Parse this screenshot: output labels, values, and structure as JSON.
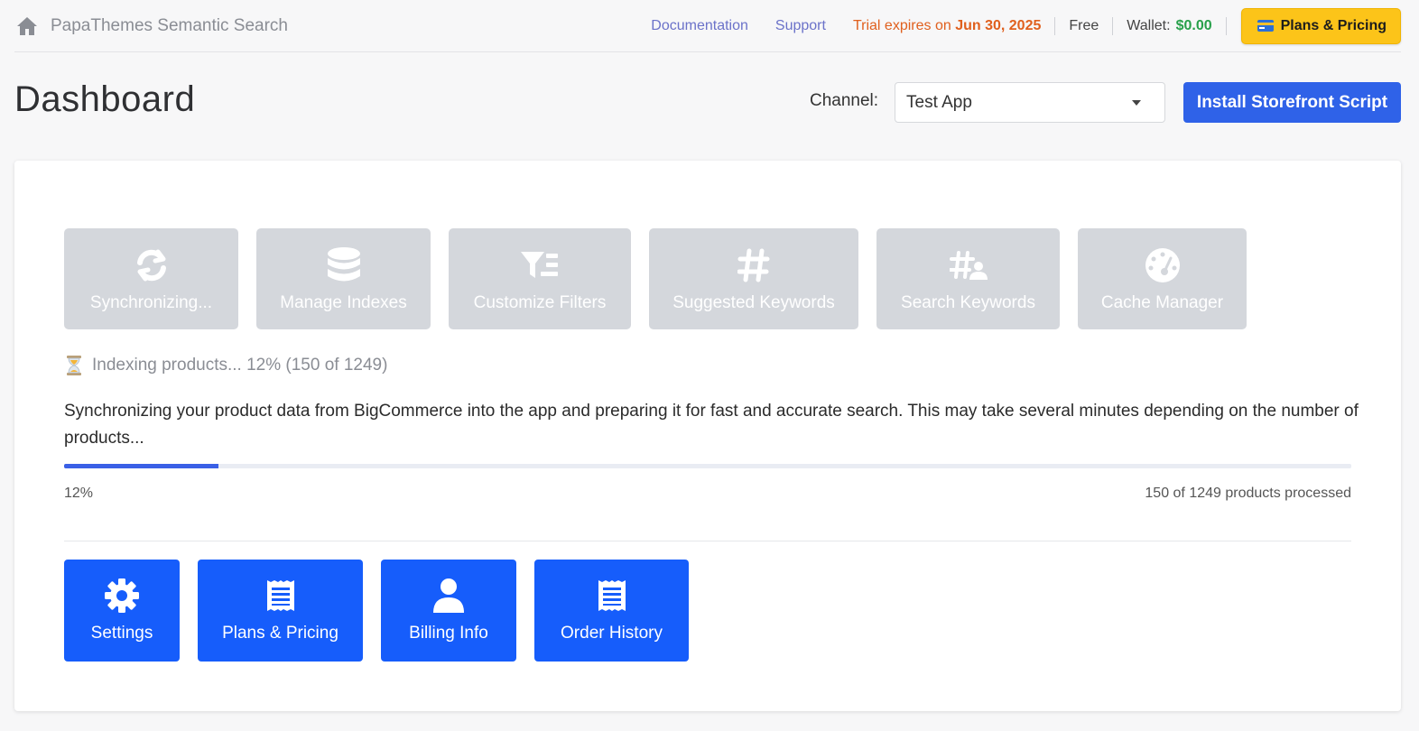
{
  "header": {
    "app_title": "PapaThemes Semantic Search",
    "documentation": "Documentation",
    "support": "Support",
    "trial_prefix": "Trial expires on",
    "trial_date": "Jun 30, 2025",
    "plan": "Free",
    "wallet_label": "Wallet:",
    "wallet_value": "$0.00",
    "plans_button": "Plans & Pricing"
  },
  "page": {
    "title": "Dashboard",
    "channel_label": "Channel:",
    "channel_value": "Test App",
    "install_button": "Install Storefront Script"
  },
  "tools": [
    {
      "label": "Synchronizing...",
      "icon": "sync-icon"
    },
    {
      "label": "Manage Indexes",
      "icon": "database-icon"
    },
    {
      "label": "Customize Filters",
      "icon": "filter-icon"
    },
    {
      "label": "Suggested Keywords",
      "icon": "hashtag-icon"
    },
    {
      "label": "Search Keywords",
      "icon": "hashtag-user-icon"
    },
    {
      "label": "Cache Manager",
      "icon": "gauge-icon"
    }
  ],
  "sync": {
    "status": "Indexing products... 12% (150 of 1249)",
    "description": "Synchronizing your product data from BigCommerce into the app and preparing it for fast and accurate search. This may take several minutes depending on the number of products...",
    "progress": 0.12,
    "percent_label": "12%",
    "processed_label": "150 of 1249 products processed"
  },
  "actions": [
    {
      "label": "Settings",
      "icon": "gear-icon"
    },
    {
      "label": "Plans & Pricing",
      "icon": "receipt-icon"
    },
    {
      "label": "Billing Info",
      "icon": "user-icon"
    },
    {
      "label": "Order History",
      "icon": "receipt-icon"
    }
  ],
  "colors": {
    "accent": "#165dfb",
    "install": "#2f62e8",
    "plans": "#fcc419",
    "trial": "#e0601e",
    "wallet": "#27a04a",
    "disabled_tile": "#d4d7dc"
  }
}
